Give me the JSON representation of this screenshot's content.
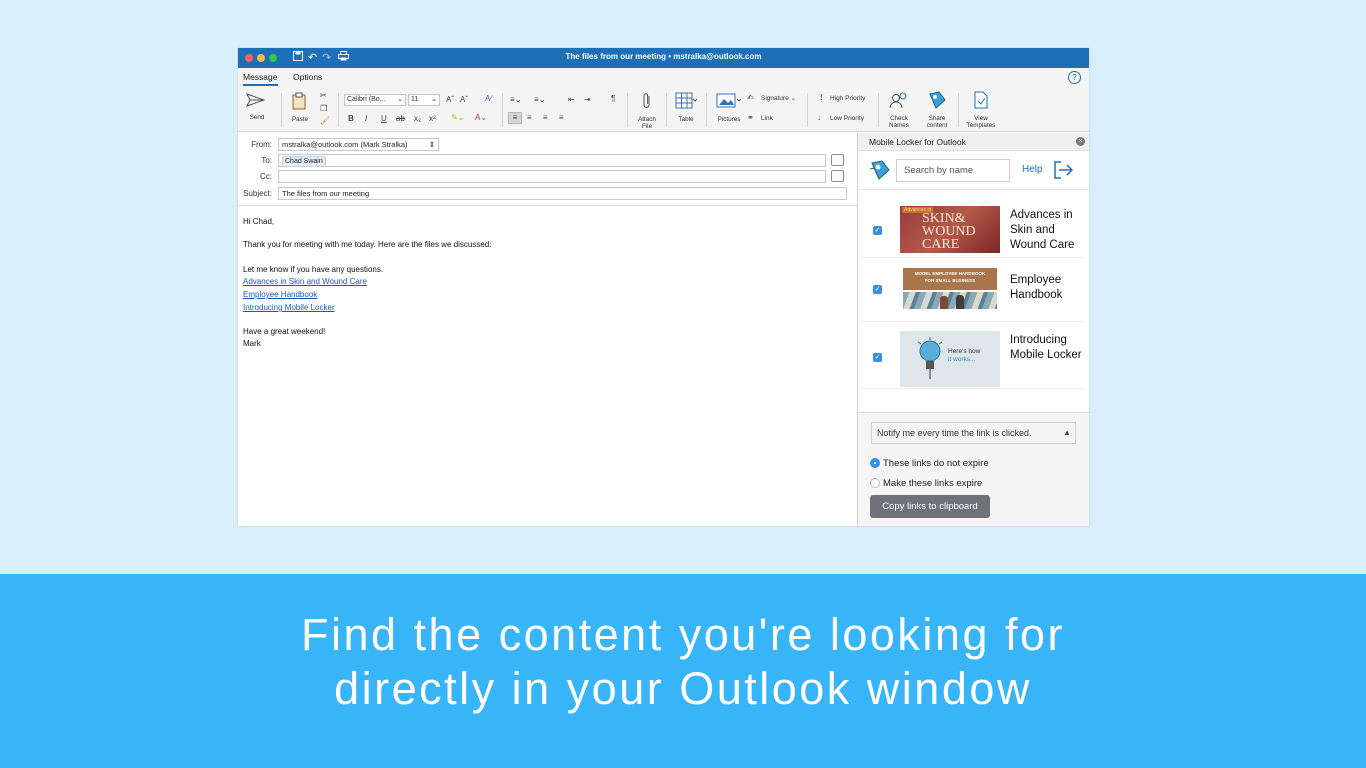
{
  "window": {
    "title": "The files from our meeting • mstralka@outlook.com"
  },
  "tabs": {
    "message": "Message",
    "options": "Options"
  },
  "ribbon": {
    "send": "Send",
    "paste": "Paste",
    "font_name": "Calibri (Bo...",
    "font_size": "11",
    "attach_file": [
      "Attach",
      "File"
    ],
    "table": "Table",
    "pictures": "Pictures",
    "signature": "Signature",
    "link": "Link",
    "high_priority": "High Priority",
    "low_priority": "Low Priority",
    "check_names": [
      "Check",
      "Names"
    ],
    "share_content": [
      "Share",
      "content"
    ],
    "view_templates": [
      "View",
      "Templates"
    ]
  },
  "compose": {
    "from_label": "From:",
    "from_value": "mstralka@outlook.com (Mark Stralka)",
    "to_label": "To:",
    "to_value": "Chad Swain",
    "cc_label": "Cc:",
    "subject_label": "Subject:",
    "subject_value": "The files from our meeting",
    "greeting": "Hi Chad,",
    "line1": "Thank you for meeting with me today. Here are the files we discussed:",
    "line2": "Let me know if you have any questions.",
    "links": [
      "Advances in Skin and Wound Care",
      "Employee Handbook",
      "Introducing Mobile Locker"
    ],
    "closing": "Have a great weekend!",
    "signature": "Mark"
  },
  "panel": {
    "title": "Mobile Locker for Outlook",
    "search_placeholder": "Search by name",
    "help": "Help",
    "items": [
      {
        "title": "Advances in Skin and Wound Care",
        "thumb_text": [
          "Advances in",
          "SKIN&",
          "WOUND",
          "CARE"
        ],
        "checked": true
      },
      {
        "title": "Employee Handbook",
        "thumb_text": [
          "MODEL EMPLOYEE HANDBOOK",
          "FOR SMALL BUSINESS"
        ],
        "checked": true
      },
      {
        "title": "Introducing Mobile Locker",
        "thumb_text": [
          "Here's how",
          "it works..."
        ],
        "checked": true
      }
    ],
    "notify_option": "Notify me every time the link is clicked.",
    "expire_options": [
      "These links do not expire",
      "Make these links expire"
    ],
    "expire_selected": 0,
    "copy_button": "Copy links to clipboard"
  },
  "banner": {
    "line1": "Find the content you're looking for",
    "line2": "directly in your Outlook window"
  },
  "colors": {
    "background": "#d9eefb",
    "titlebar": "#1d6fb8",
    "banner": "#38b4f9",
    "link": "#1a56c4",
    "checkbox": "#3b8fe0",
    "copy_button": "#6f7378"
  }
}
